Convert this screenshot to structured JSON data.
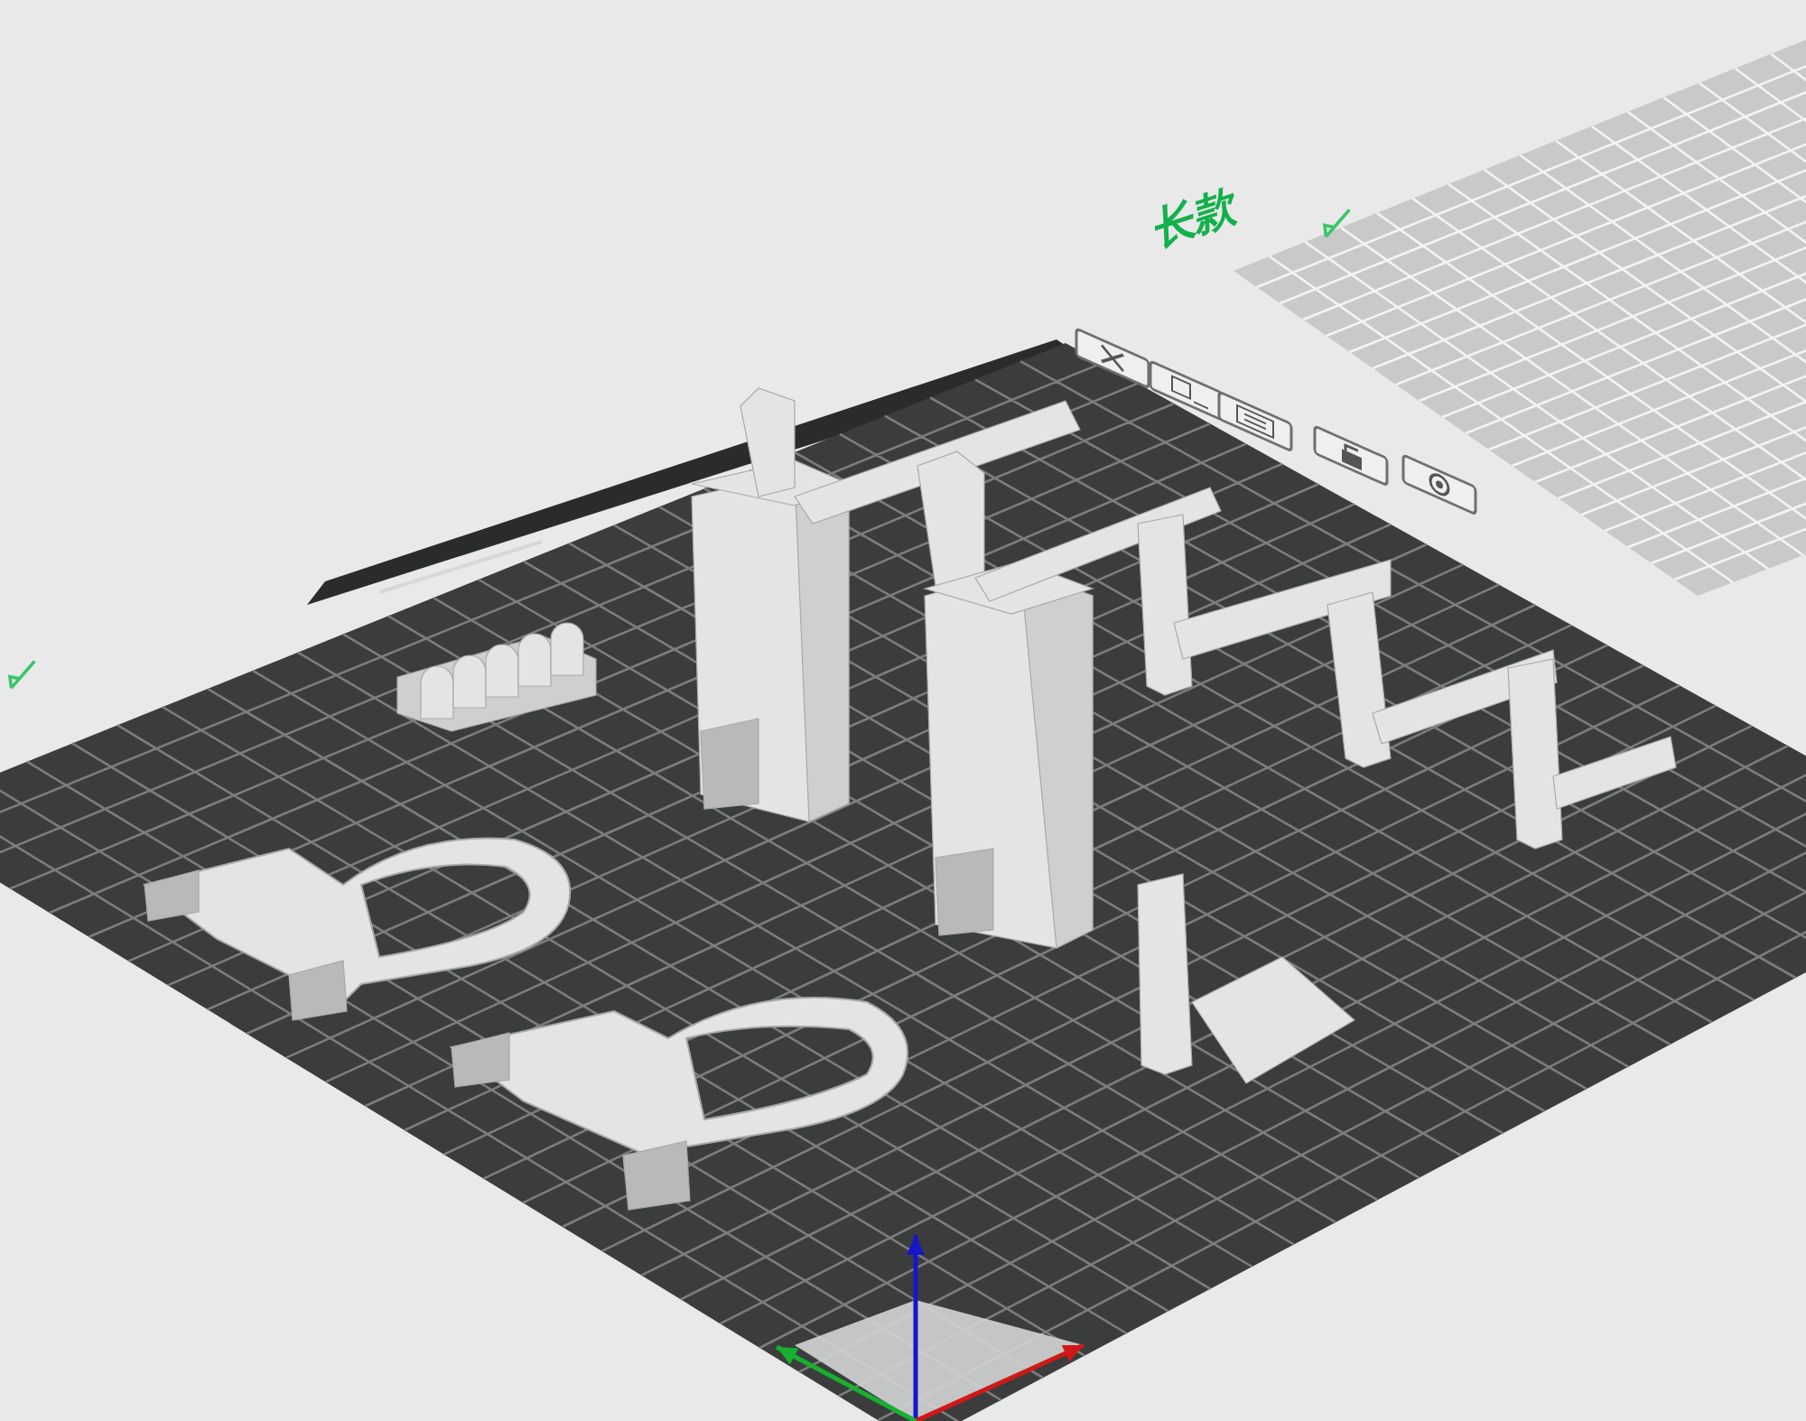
{
  "viewport": {
    "plates": [
      {
        "selected": true
      },
      {
        "name": "长款",
        "selected": false
      }
    ]
  }
}
